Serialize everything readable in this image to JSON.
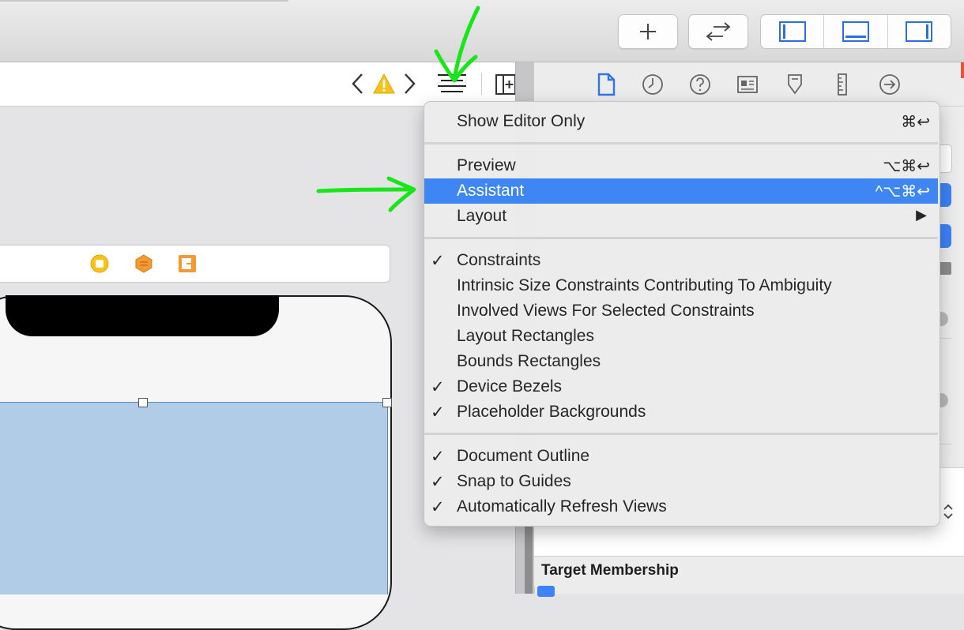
{
  "menu": {
    "items": [
      {
        "label": "Show Editor Only",
        "shortcut": "⌘↩",
        "checked": false,
        "selected": false
      },
      {
        "label": "Preview",
        "shortcut": "⌥⌘↩",
        "checked": false,
        "selected": false
      },
      {
        "label": "Assistant",
        "shortcut": "^⌥⌘↩",
        "checked": false,
        "selected": true
      },
      {
        "label": "Layout",
        "shortcut": "▶",
        "checked": false,
        "selected": false
      },
      {
        "label": "Constraints",
        "checked": true,
        "selected": false
      },
      {
        "label": "Intrinsic Size Constraints Contributing To Ambiguity",
        "checked": false,
        "selected": false
      },
      {
        "label": "Involved Views For Selected Constraints",
        "checked": false,
        "selected": false
      },
      {
        "label": "Layout Rectangles",
        "checked": false,
        "selected": false
      },
      {
        "label": "Bounds Rectangles",
        "checked": false,
        "selected": false
      },
      {
        "label": "Device Bezels",
        "checked": true,
        "selected": false
      },
      {
        "label": "Placeholder Backgrounds",
        "checked": true,
        "selected": false
      },
      {
        "label": "Document Outline",
        "checked": true,
        "selected": false
      },
      {
        "label": "Snap to Guides",
        "checked": true,
        "selected": false
      },
      {
        "label": "Automatically Refresh Views",
        "checked": true,
        "selected": false
      }
    ],
    "check_glyph": "✓"
  },
  "inspector": {
    "target_membership_title": "Target Membership",
    "tabs": [
      "file-icon",
      "clock-icon",
      "help-icon",
      "identity-icon",
      "attributes-icon",
      "size-ruler-icon",
      "connections-icon"
    ]
  },
  "toolbar": {
    "buttons": [
      "add-icon",
      "swap-arrows-icon"
    ],
    "layout_toggles": [
      "left-panel-icon",
      "bottom-panel-icon",
      "right-panel-icon"
    ]
  },
  "jumpbar": {
    "icons": [
      "chevron-left-icon",
      "warning-icon",
      "chevron-right-icon",
      "editor-options-icon",
      "add-editor-icon"
    ]
  },
  "scene": {
    "icons": [
      "view-controller-icon",
      "first-responder-icon",
      "exit-icon"
    ]
  },
  "colors": {
    "selection": "#3f86f5",
    "annotation": "#18e61a",
    "view_background": "#b1cce7",
    "warning": "#f7c21a"
  }
}
